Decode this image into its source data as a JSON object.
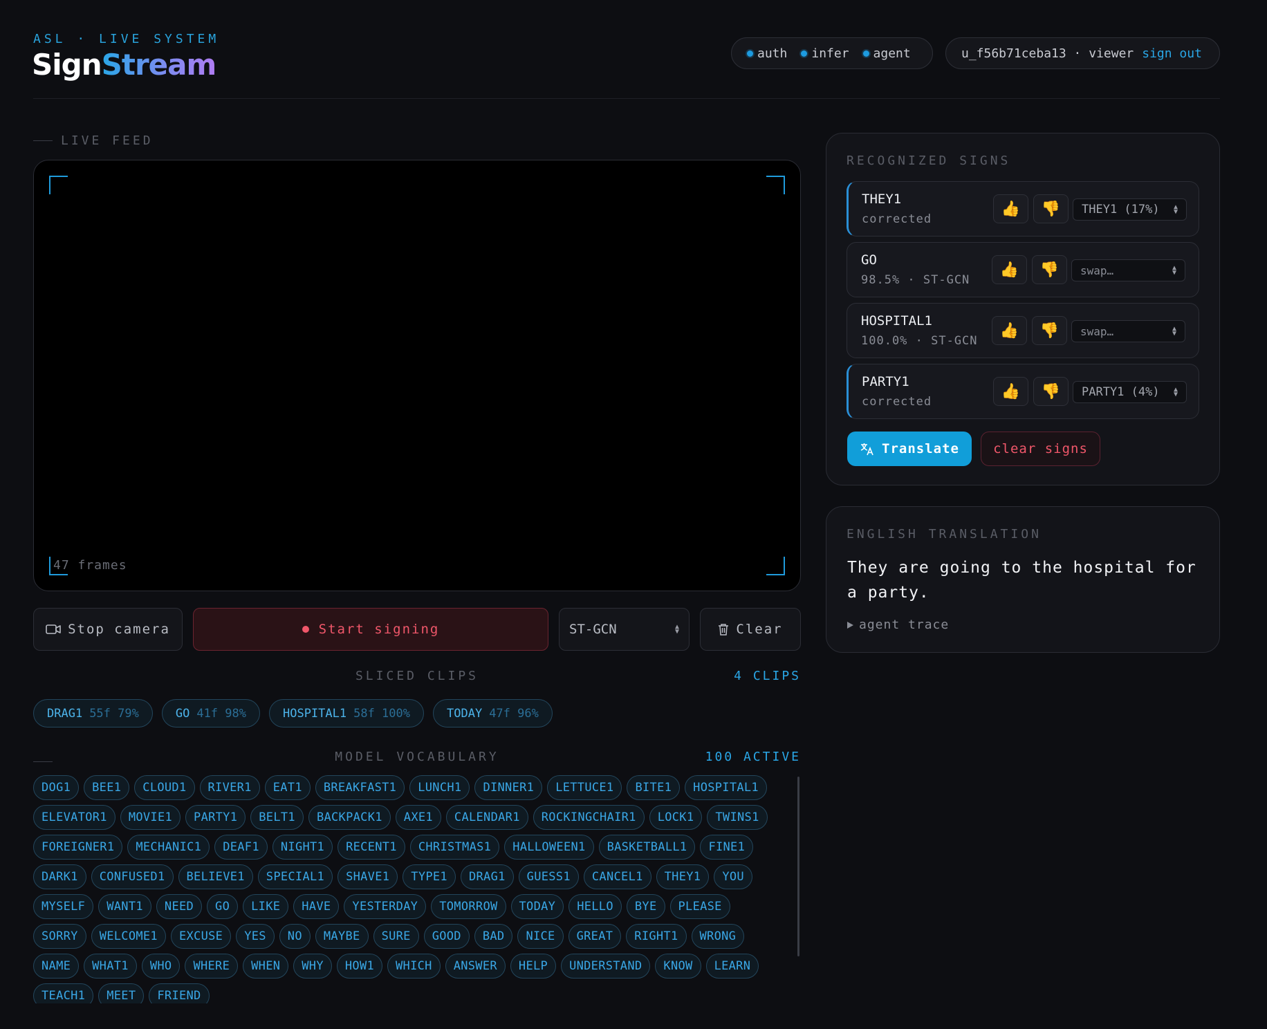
{
  "header": {
    "eyebrow": "ASL · LIVE SYSTEM",
    "logo_part1": "Sign",
    "logo_part2": "Stream",
    "services": [
      {
        "label": "auth"
      },
      {
        "label": "infer"
      },
      {
        "label": "agent"
      }
    ],
    "user_text": "u_f56b71ceba13 · viewer",
    "signout_label": "sign out"
  },
  "feed": {
    "label": "LIVE FEED",
    "frames_text": "47 frames"
  },
  "controls": {
    "stop_camera_label": "Stop camera",
    "start_signing_label": "Start signing",
    "model_selected": "ST-GCN",
    "clear_label": "Clear"
  },
  "clips": {
    "label": "SLICED CLIPS",
    "count_text": "4 CLIPS",
    "items": [
      {
        "name": "DRAG1",
        "meta": "55f 79%"
      },
      {
        "name": "GO",
        "meta": "41f 98%"
      },
      {
        "name": "HOSPITAL1",
        "meta": "58f 100%"
      },
      {
        "name": "TODAY",
        "meta": "47f 96%"
      }
    ]
  },
  "vocab": {
    "label": "MODEL VOCABULARY",
    "count_text": "100 ACTIVE",
    "words": [
      "DOG1",
      "BEE1",
      "CLOUD1",
      "RIVER1",
      "EAT1",
      "BREAKFAST1",
      "LUNCH1",
      "DINNER1",
      "LETTUCE1",
      "BITE1",
      "HOSPITAL1",
      "ELEVATOR1",
      "MOVIE1",
      "PARTY1",
      "BELT1",
      "BACKPACK1",
      "AXE1",
      "CALENDAR1",
      "ROCKINGCHAIR1",
      "LOCK1",
      "TWINS1",
      "FOREIGNER1",
      "MECHANIC1",
      "DEAF1",
      "NIGHT1",
      "RECENT1",
      "CHRISTMAS1",
      "HALLOWEEN1",
      "BASKETBALL1",
      "FINE1",
      "DARK1",
      "CONFUSED1",
      "BELIEVE1",
      "SPECIAL1",
      "SHAVE1",
      "TYPE1",
      "DRAG1",
      "GUESS1",
      "CANCEL1",
      "THEY1",
      "YOU",
      "MYSELF",
      "WANT1",
      "NEED",
      "GO",
      "LIKE",
      "HAVE",
      "YESTERDAY",
      "TOMORROW",
      "TODAY",
      "HELLO",
      "BYE",
      "PLEASE",
      "SORRY",
      "WELCOME1",
      "EXCUSE",
      "YES",
      "NO",
      "MAYBE",
      "SURE",
      "GOOD",
      "BAD",
      "NICE",
      "GREAT",
      "RIGHT1",
      "WRONG",
      "NAME",
      "WHAT1",
      "WHO",
      "WHERE",
      "WHEN",
      "WHY",
      "HOW1",
      "WHICH",
      "ANSWER",
      "HELP",
      "UNDERSTAND",
      "KNOW",
      "LEARN",
      "TEACH1",
      "MEET",
      "FRIEND"
    ]
  },
  "recognized": {
    "label": "RECOGNIZED SIGNS",
    "items": [
      {
        "name": "THEY1",
        "sub": "corrected",
        "select": "THEY1 (17%)",
        "corrected": true
      },
      {
        "name": "GO",
        "sub": "98.5% · ST-GCN",
        "select": "swap…",
        "corrected": false
      },
      {
        "name": "HOSPITAL1",
        "sub": "100.0% · ST-GCN",
        "select": "swap…",
        "corrected": false
      },
      {
        "name": "PARTY1",
        "sub": "corrected",
        "select": "PARTY1 (4%)",
        "corrected": true
      }
    ],
    "translate_label": "Translate",
    "clear_signs_label": "clear signs"
  },
  "translation": {
    "label": "ENGLISH TRANSLATION",
    "text": "They are going to the hospital for a party.",
    "agent_trace_label": "agent trace"
  },
  "colors": {
    "accent": "#1d9be0",
    "danger": "#f0576a",
    "background": "#0d0e12"
  }
}
